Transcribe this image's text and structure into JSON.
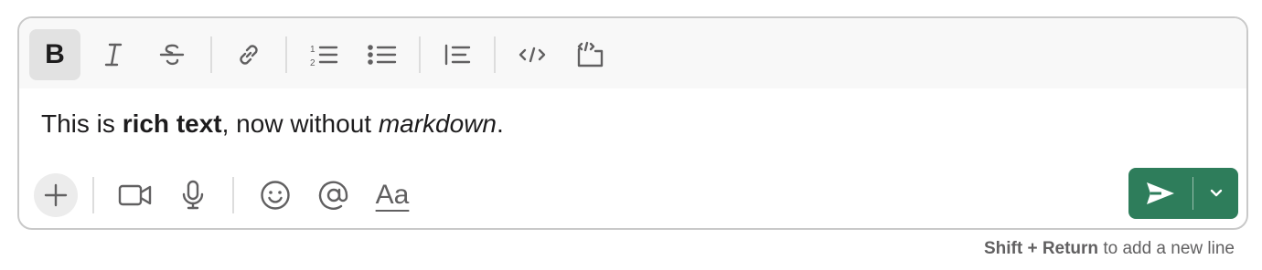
{
  "colors": {
    "border": "#c9c9c9",
    "toolbar_bg": "#f8f8f8",
    "active_bg": "#e2e2e2",
    "icon": "#616061",
    "text": "#1d1c1d",
    "send_bg": "#2e7d5b"
  },
  "formatting_toolbar": {
    "bold_label": "B",
    "icons": [
      "bold-icon",
      "italic-icon",
      "strikethrough-icon",
      "link-icon",
      "ordered-list-icon",
      "bulleted-list-icon",
      "blockquote-icon",
      "code-icon",
      "code-block-icon"
    ],
    "active": "bold"
  },
  "editor": {
    "text_before": "This is ",
    "bold_text": "rich text",
    "text_middle": ", now without ",
    "italic_text": "markdown",
    "text_after": "."
  },
  "bottom_toolbar": {
    "icons": [
      "plus-icon",
      "video-icon",
      "microphone-icon",
      "emoji-icon",
      "mention-icon",
      "text-format-icon"
    ],
    "format_label": "Aa"
  },
  "send": {
    "icons": [
      "send-icon",
      "chevron-down-icon"
    ]
  },
  "hint": {
    "keys": "Shift + Return",
    "text": " to add a new line"
  }
}
